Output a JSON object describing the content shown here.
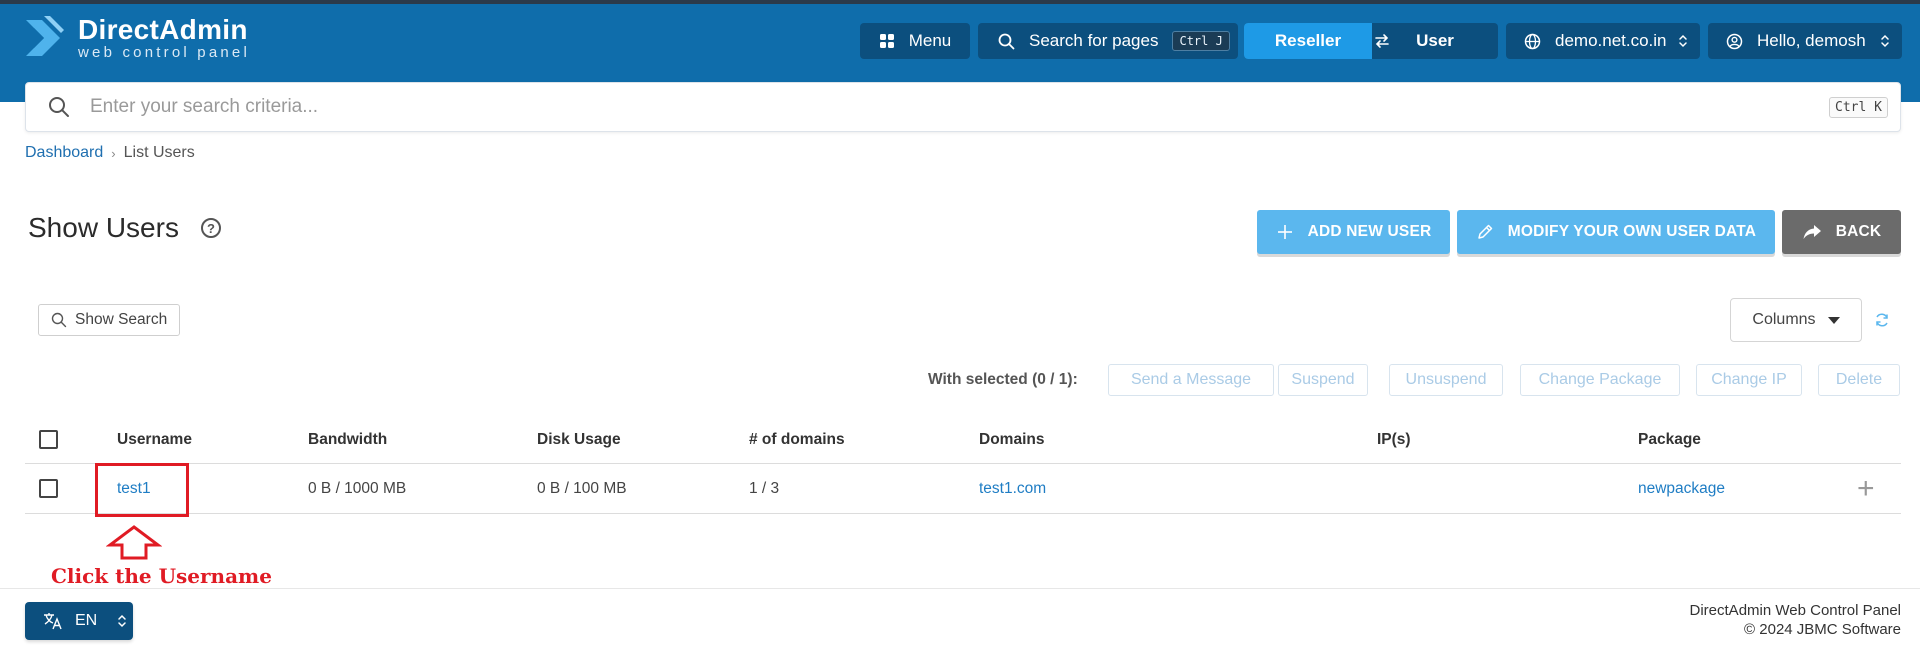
{
  "header": {
    "logo_title": "DirectAdmin",
    "logo_subtitle": "web control panel",
    "menu_label": "Menu",
    "search_pages_label": "Search for pages",
    "search_pages_shortcut": "Ctrl J",
    "toggle_active": "Reseller",
    "toggle_inactive": "User",
    "domain": "demo.net.co.in",
    "greeting": "Hello, demosh"
  },
  "search": {
    "placeholder": "Enter your search criteria...",
    "shortcut": "Ctrl K"
  },
  "breadcrumb": {
    "home": "Dashboard",
    "current": "List Users"
  },
  "page": {
    "title": "Show Users",
    "help_glyph": "?"
  },
  "actions": {
    "add_user": "ADD NEW USER",
    "modify": "MODIFY YOUR OWN USER DATA",
    "back": "BACK"
  },
  "toolbar": {
    "show_search": "Show Search",
    "columns": "Columns",
    "with_selected": "With selected (0 / 1):",
    "buttons": [
      "Send a Message",
      "Suspend",
      "Unsuspend",
      "Change Package",
      "Change IP",
      "Delete"
    ]
  },
  "table": {
    "headers": [
      "Username",
      "Bandwidth",
      "Disk Usage",
      "# of domains",
      "Domains",
      "IP(s)",
      "Package"
    ],
    "rows": [
      {
        "username": "test1",
        "bandwidth": "0 B / 1000 MB",
        "disk": "0 B / 100 MB",
        "domains_count": "1 / 3",
        "domains": "test1.com",
        "ips": "",
        "package": "newpackage"
      }
    ]
  },
  "annotation": {
    "text": "Click the Username",
    "color": "#e01b24"
  },
  "footer": {
    "lang": "EN",
    "product": "DirectAdmin Web Control Panel",
    "copyright": "© 2024 JBMC Software"
  },
  "colors": {
    "header_bg": "#0f6dab",
    "header_button": "#0c4f7e",
    "accent_blue": "#1e9ae6",
    "action_blue": "#5bb7ee",
    "back_grey": "#6b6b6b",
    "link": "#1f7dc4"
  }
}
